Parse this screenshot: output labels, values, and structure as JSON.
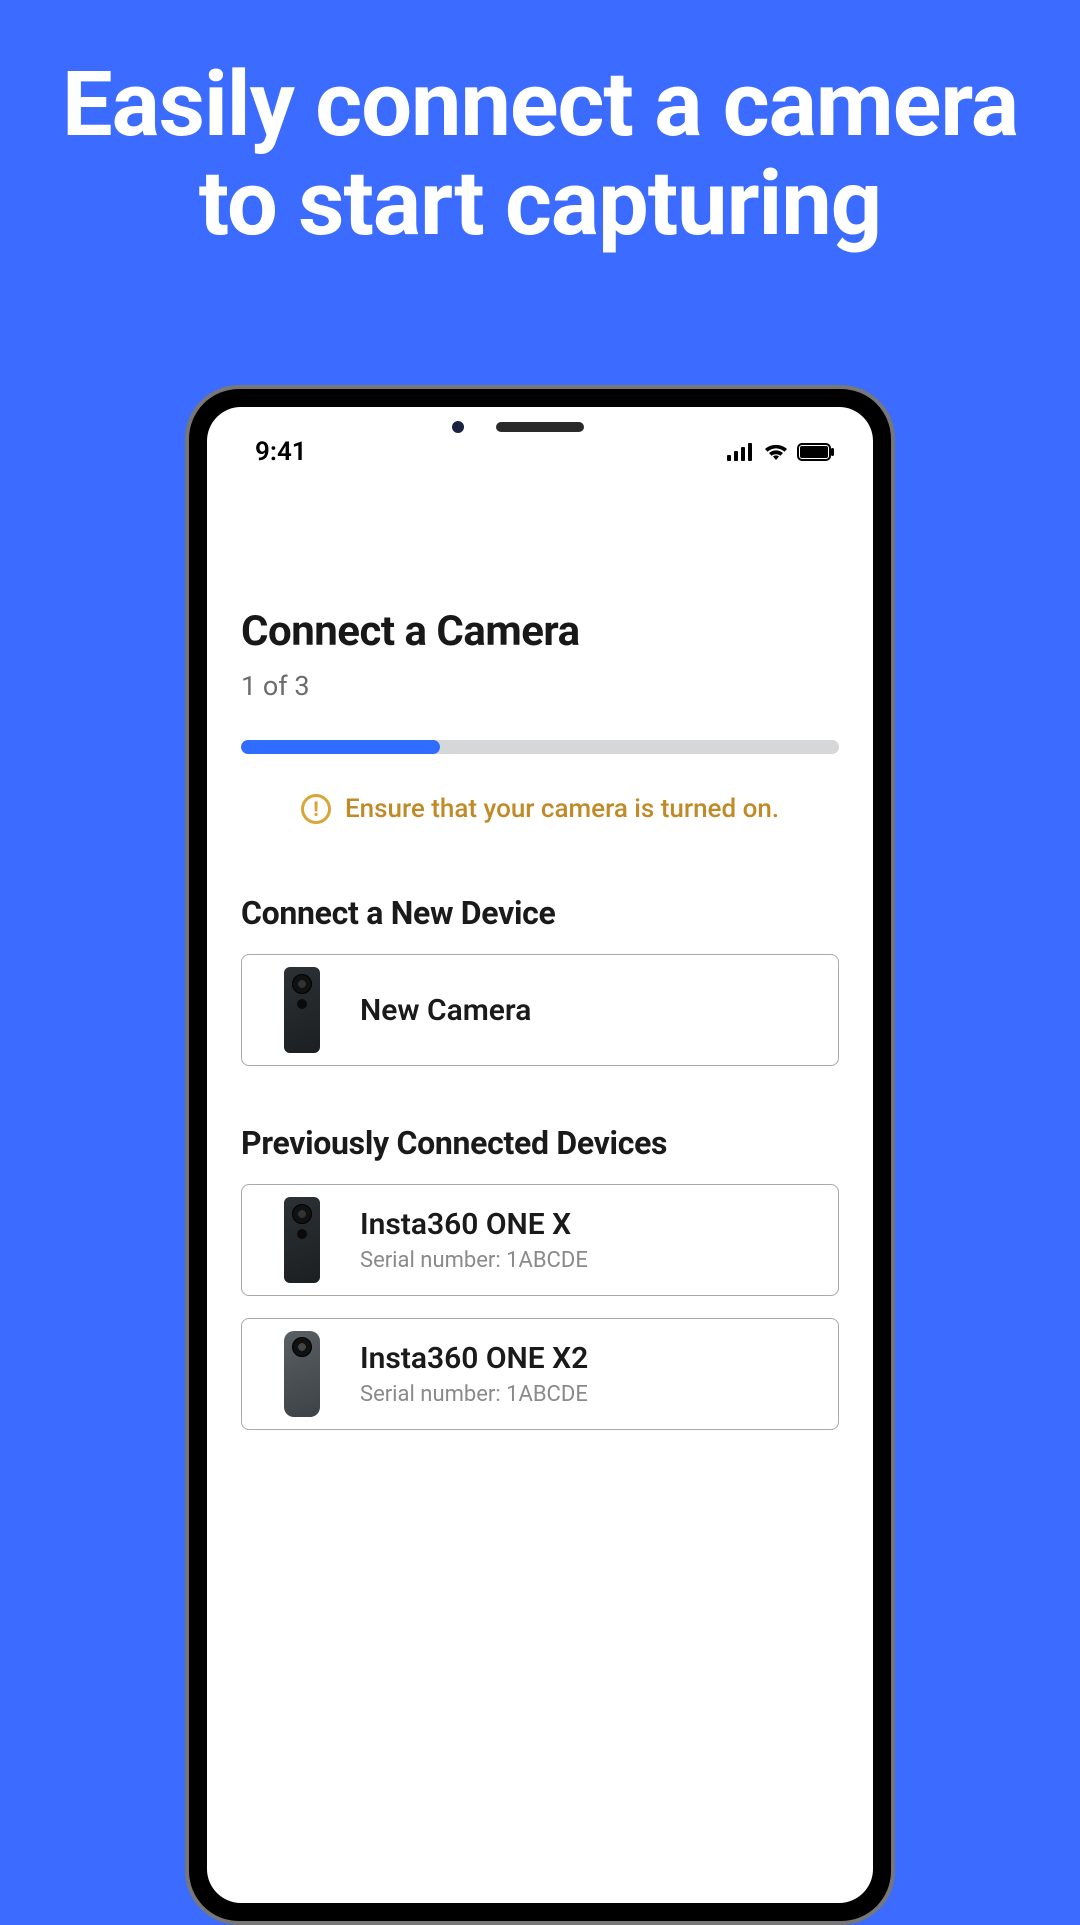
{
  "headline": "Easily connect a camera to start capturing",
  "status": {
    "time": "9:41"
  },
  "page": {
    "title": "Connect a Camera",
    "step": "1 of 3",
    "progress_percent": 33.3
  },
  "alert": {
    "text": "Ensure that your camera is turned on."
  },
  "new_section": {
    "title": "Connect a New Device",
    "item": {
      "label": "New Camera"
    }
  },
  "prev_section": {
    "title": "Previously Connected Devices",
    "items": [
      {
        "name": "Insta360 ONE X",
        "serial": "Serial number: 1ABCDE"
      },
      {
        "name": "Insta360 ONE X2",
        "serial": "Serial number: 1ABCDE"
      }
    ]
  }
}
